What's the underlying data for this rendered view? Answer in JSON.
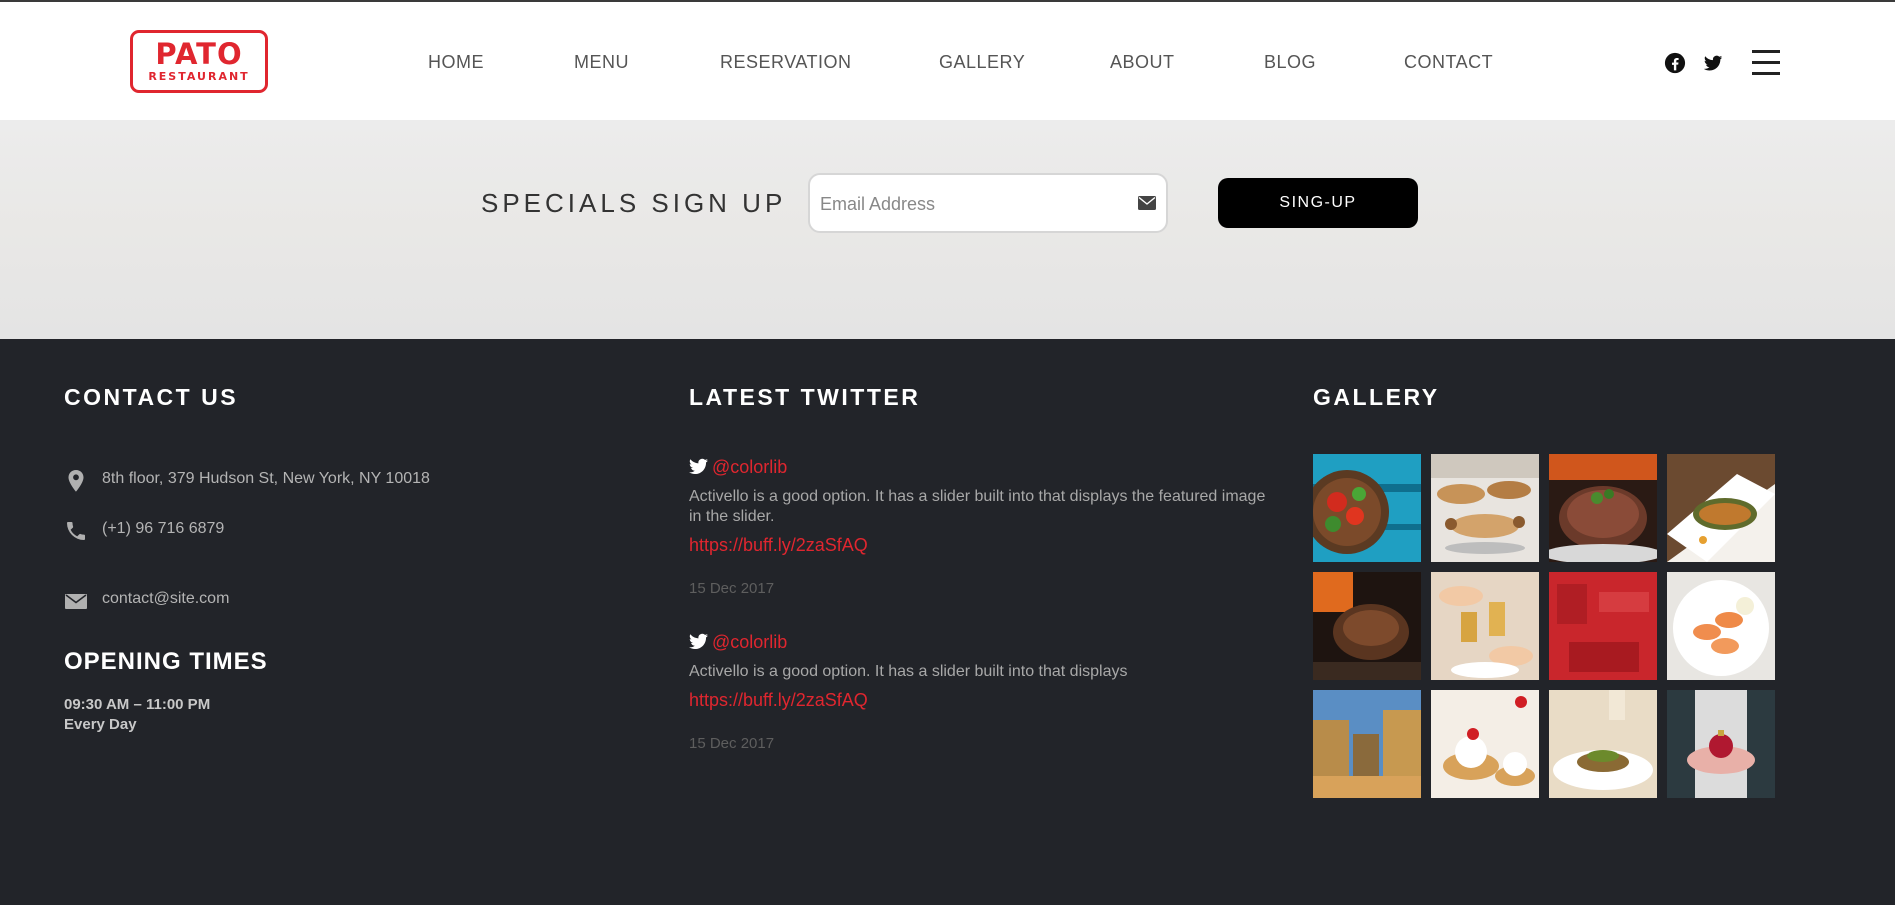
{
  "header": {
    "logo": {
      "line1": "PATO",
      "line2": "RESTAURANT"
    },
    "nav": [
      {
        "label": "HOME"
      },
      {
        "label": "MENU"
      },
      {
        "label": "RESERVATION"
      },
      {
        "label": "GALLERY"
      },
      {
        "label": "ABOUT"
      },
      {
        "label": "BLOG"
      },
      {
        "label": "CONTACT"
      }
    ],
    "social": [
      "facebook-icon",
      "twitter-icon"
    ],
    "menu_icon": "hamburger-icon"
  },
  "signup": {
    "title": "SPECIALS SIGN UP",
    "email_placeholder": "Email Address",
    "button_label": "SING-UP"
  },
  "footer": {
    "contact": {
      "title": "CONTACT US",
      "address": "8th floor, 379 Hudson St, New York, NY 10018",
      "phone": "(+1) 96 716 6879",
      "email": "contact@site.com"
    },
    "opening": {
      "title": "OPENING TIMES",
      "hours": "09:30 AM – 11:00 PM",
      "days": "Every Day"
    },
    "twitter": {
      "title": "LATEST TWITTER",
      "tweets": [
        {
          "handle": "@colorlib",
          "text": "Activello is a good option. It has a slider built into that displays the featured image in the slider.",
          "link": "https://buff.ly/2zaSfAQ",
          "date": "15 Dec 2017"
        },
        {
          "handle": "@colorlib",
          "text": "Activello is a good option. It has a slider built into that displays",
          "link": "https://buff.ly/2zaSfAQ",
          "date": "15 Dec 2017"
        }
      ]
    },
    "gallery": {
      "title": "GALLERY",
      "images": [
        "salad-bowl-image",
        "pastry-buffet-image",
        "grilled-steak-image",
        "salmon-fillet-image",
        "roast-meat-image",
        "toast-drinks-image",
        "red-restaurant-image",
        "shrimp-plate-image",
        "city-street-image",
        "cherry-dessert-image",
        "plated-dish-image",
        "hands-ornament-image"
      ]
    }
  },
  "colors": {
    "accent": "#e0262f",
    "footer_bg": "#222429",
    "header_bg": "#ffffff",
    "button_bg": "#000000"
  }
}
